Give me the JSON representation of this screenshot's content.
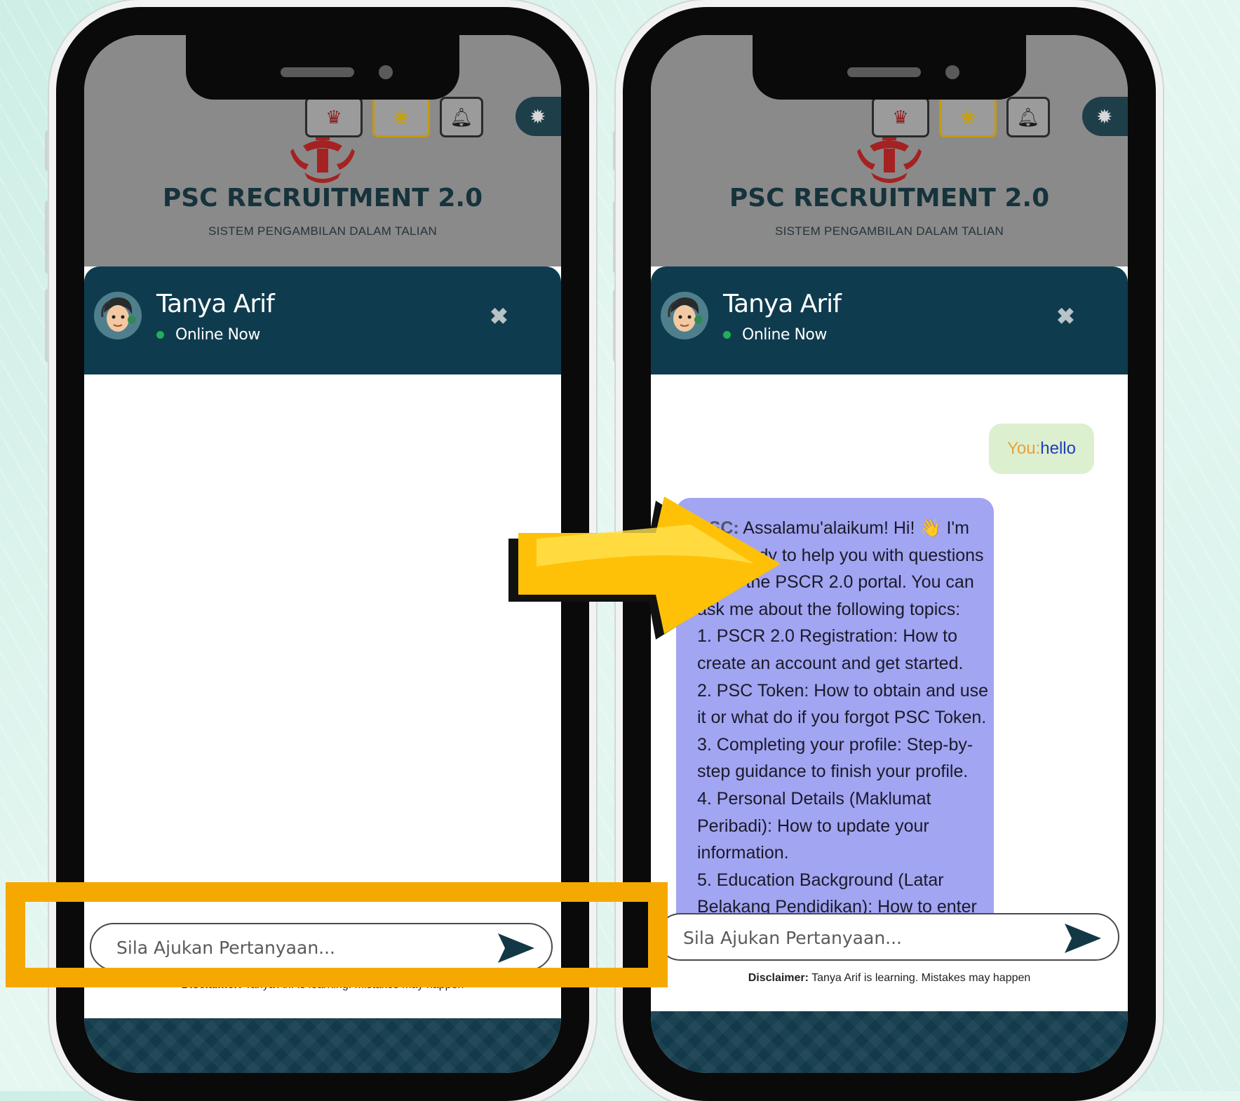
{
  "left_phone": {
    "brand_title": "PSC RECRUITMENT 2.0",
    "brand_subtitle": "SISTEM PENGAMBILAN DALAM TALIAN",
    "bot_name": "Tanya Arif",
    "bot_status": "Online Now",
    "input_placeholder": "Sila Ajukan Pertanyaan...",
    "disclaimer_label": "Disclaimer:",
    "disclaimer_text": "Tanya Arif is learning. Mistakes may happen"
  },
  "right_phone": {
    "brand_title": "PSC RECRUITMENT 2.0",
    "brand_subtitle": "SISTEM PENGAMBILAN DALAM TALIAN",
    "bot_name": "Tanya Arif",
    "bot_status": "Online Now",
    "user_label": "You:",
    "user_message": "hello",
    "bot_label": "PSC:",
    "bot_lines": [
      " Assalamu'alaikum! Hi! 👋 I'm",
      "Arif, ready to help you with questions",
      "about the PSCR 2.0 portal. You can",
      "ask me about the following topics:",
      "1. PSCR 2.0 Registration: How to",
      "create an account and get started.",
      "2. PSC Token: How to obtain and use",
      "it or what do if you forgot PSC Token.",
      "3. Completing your profile: Step-by-",
      "step guidance to finish your profile.",
      "4. Personal Details (Maklumat",
      "Peribadi): How to update your",
      "information.",
      "5. Education Background (Latar",
      "Belakang Pendidikan): How to enter"
    ],
    "input_placeholder": "Sila Ajukan Pertanyaan...",
    "disclaimer_label": "Disclaimer:",
    "disclaimer_text": "Tanya Arif is learning. Mistakes may happen"
  },
  "icons": {
    "crest": "brunei-crest-icon",
    "flower": "simpor-flower-icon",
    "bell": "bell-icon",
    "theme": "sun-icon",
    "close": "close-icon",
    "send": "send-arrow-icon"
  },
  "colors": {
    "header_dark": "#0f3b4e",
    "bot_bubble": "#a2a5f1",
    "user_bubble": "#dcefcf",
    "highlight": "#f5a800",
    "arrow": "#ffc107"
  }
}
